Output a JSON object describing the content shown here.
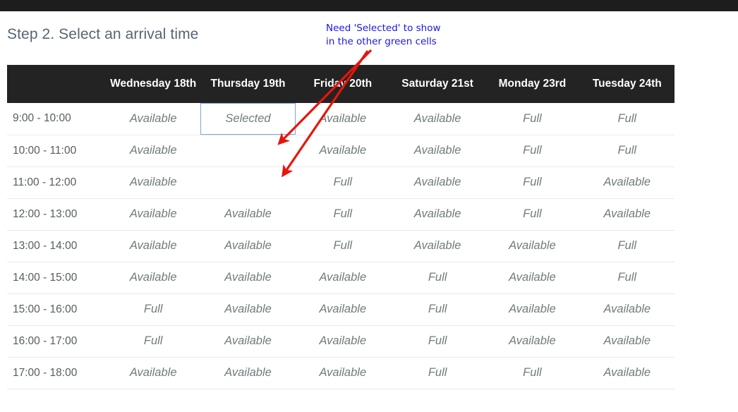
{
  "page": {
    "title": "Step 2. Select an arrival time"
  },
  "annotation": {
    "text": "Need 'Selected' to show\nin the other green cells",
    "color": "#1a16e6"
  },
  "colors": {
    "header_bg": "#232323",
    "full": "#f4231a",
    "selected_green": "#2ecc71",
    "selected_outline": "#7ba7dd",
    "available_text": "#707b7c",
    "title_text": "#566573",
    "top_bar": "#1d1d1d"
  },
  "labels": {
    "available": "Available",
    "full": "Full",
    "selected": "Selected",
    "blank": ""
  },
  "table": {
    "corner_header": "",
    "columns": [
      "Wednesday 18th",
      "Thursday 19th",
      "Friday 20th",
      "Saturday 21st",
      "Monday 23rd",
      "Tuesday 24th"
    ],
    "rows": [
      {
        "time": "9:00 - 10:00",
        "cells": [
          {
            "label": "Available",
            "state": "available"
          },
          {
            "label": "Selected",
            "state": "selected"
          },
          {
            "label": "Available",
            "state": "available"
          },
          {
            "label": "Available",
            "state": "available"
          },
          {
            "label": "Full",
            "state": "full"
          },
          {
            "label": "Full",
            "state": "full"
          }
        ]
      },
      {
        "time": "10:00 - 11:00",
        "cells": [
          {
            "label": "Available",
            "state": "available"
          },
          {
            "label": "",
            "state": "green"
          },
          {
            "label": "Available",
            "state": "available"
          },
          {
            "label": "Available",
            "state": "available"
          },
          {
            "label": "Full",
            "state": "full"
          },
          {
            "label": "Full",
            "state": "full"
          }
        ]
      },
      {
        "time": "11:00 - 12:00",
        "cells": [
          {
            "label": "Available",
            "state": "available"
          },
          {
            "label": "",
            "state": "green"
          },
          {
            "label": "Full",
            "state": "full"
          },
          {
            "label": "Available",
            "state": "available"
          },
          {
            "label": "Full",
            "state": "full"
          },
          {
            "label": "Available",
            "state": "available"
          }
        ]
      },
      {
        "time": "12:00 - 13:00",
        "cells": [
          {
            "label": "Available",
            "state": "available"
          },
          {
            "label": "Available",
            "state": "available"
          },
          {
            "label": "Full",
            "state": "full"
          },
          {
            "label": "Available",
            "state": "available"
          },
          {
            "label": "Full",
            "state": "full"
          },
          {
            "label": "Available",
            "state": "available"
          }
        ]
      },
      {
        "time": "13:00 - 14:00",
        "cells": [
          {
            "label": "Available",
            "state": "available"
          },
          {
            "label": "Available",
            "state": "available"
          },
          {
            "label": "Full",
            "state": "full"
          },
          {
            "label": "Available",
            "state": "available"
          },
          {
            "label": "Available",
            "state": "available"
          },
          {
            "label": "Full",
            "state": "full"
          }
        ]
      },
      {
        "time": "14:00 - 15:00",
        "cells": [
          {
            "label": "Available",
            "state": "available"
          },
          {
            "label": "Available",
            "state": "available"
          },
          {
            "label": "Available",
            "state": "available"
          },
          {
            "label": "Full",
            "state": "full"
          },
          {
            "label": "Available",
            "state": "available"
          },
          {
            "label": "Full",
            "state": "full"
          }
        ]
      },
      {
        "time": "15:00 - 16:00",
        "cells": [
          {
            "label": "Full",
            "state": "full"
          },
          {
            "label": "Available",
            "state": "available"
          },
          {
            "label": "Available",
            "state": "available"
          },
          {
            "label": "Full",
            "state": "full"
          },
          {
            "label": "Available",
            "state": "available"
          },
          {
            "label": "Available",
            "state": "available"
          }
        ]
      },
      {
        "time": "16:00 - 17:00",
        "cells": [
          {
            "label": "Full",
            "state": "full"
          },
          {
            "label": "Available",
            "state": "available"
          },
          {
            "label": "Available",
            "state": "available"
          },
          {
            "label": "Full",
            "state": "full"
          },
          {
            "label": "Available",
            "state": "available"
          },
          {
            "label": "Available",
            "state": "available"
          }
        ]
      },
      {
        "time": "17:00 - 18:00",
        "cells": [
          {
            "label": "Available",
            "state": "available"
          },
          {
            "label": "Available",
            "state": "available"
          },
          {
            "label": "Available",
            "state": "available"
          },
          {
            "label": "Full",
            "state": "full"
          },
          {
            "label": "Full",
            "state": "full"
          },
          {
            "label": "Available",
            "state": "available"
          }
        ]
      }
    ]
  }
}
